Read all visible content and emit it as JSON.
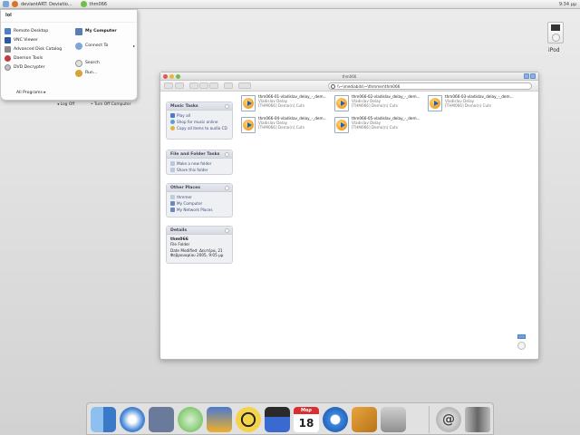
{
  "menubar": {
    "items": [
      "deviantART: Deviatio...",
      "thm066"
    ],
    "clock": "9:34 μμ"
  },
  "startmenu": {
    "user": "lol",
    "left_items": [
      "Remote Desktop",
      "VNC Viewer",
      "Advanced Disk Catalog",
      "Daemon Tools",
      "DVD Decrypter"
    ],
    "right_items": [
      "My Computer",
      "Connect To",
      "Search",
      "Run..."
    ],
    "all_programs": "All Programs",
    "log_off": "Log Off",
    "turn_off": "Turn Off Computer"
  },
  "desktop": {
    "ipod_label": "iPod"
  },
  "window": {
    "title": "thm066",
    "address": "\\\\~\\mediabits\\~\\thmmer\\thm066"
  },
  "panes": {
    "music": {
      "title": "Music Tasks",
      "items": [
        "Play all",
        "Shop for music online",
        "Copy all items to audio CD"
      ]
    },
    "folder": {
      "title": "File and Folder Tasks",
      "items": [
        "Make a new folder",
        "Share this folder"
      ]
    },
    "places": {
      "title": "Other Places",
      "items": [
        "thmmer",
        "My Computer",
        "My Network Places"
      ]
    },
    "details": {
      "title": "Details",
      "name": "thm066",
      "type": "File Folder",
      "modified": "Date Modified: Δευτέρα, 21 Φεβρουαρίου 2005, 9:05 μμ"
    }
  },
  "files": [
    {
      "name": "thm066-01-vladislav_delay_-_dem...",
      "artist": "Vladislav Delay",
      "album": "[THM066] Demo(n) Cuts"
    },
    {
      "name": "thm066-02-vladislav_delay_-_dem...",
      "artist": "Vladislav Delay",
      "album": "[THM066] Demo(n) Cuts"
    },
    {
      "name": "thm066-03-vladislav_delay_-_dem...",
      "artist": "Vladislav Delay",
      "album": "[THM066] Demo(n) Cuts"
    },
    {
      "name": "thm066-04-vladislav_delay_-_dem...",
      "artist": "Vladislav Delay",
      "album": "[THM066] Demo(n) Cuts"
    },
    {
      "name": "thm066-05-vladislav_delay_-_dem...",
      "artist": "Vladislav Delay",
      "album": "[THM066] Demo(n) Cuts"
    }
  ],
  "dock": {
    "calendar_month": "Μαρ",
    "calendar_day": "18",
    "icons": [
      "finder-icon",
      "safari-icon",
      "quicksilver-icon",
      "itunes-icon",
      "imovie-icon",
      "nuclear-icon",
      "clapper-icon",
      "ical-icon",
      "quicktime-icon",
      "mail-icon",
      "system-prefs-icon",
      "mail-at-icon",
      "trash-icon"
    ]
  }
}
